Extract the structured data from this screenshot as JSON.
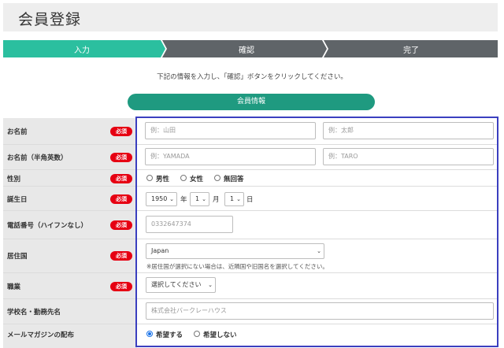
{
  "page_title": "会員登録",
  "steps": [
    {
      "label": "入力",
      "color": "#2bbf9f"
    },
    {
      "label": "確認",
      "color": "#5f6468"
    },
    {
      "label": "完了",
      "color": "#5f6468"
    }
  ],
  "instruction": "下記の情報を入力し、「確認」ボタンをクリックしてください。",
  "section_title": "会員情報",
  "required_badge": "必須",
  "form": {
    "name": {
      "label": "お名前",
      "last_placeholder": "例：山田",
      "first_placeholder": "例：太郎"
    },
    "name_en": {
      "label": "お名前（半角英数）",
      "last_placeholder": "例：YAMADA",
      "first_placeholder": "例：TARO"
    },
    "gender": {
      "label": "性別",
      "options": [
        "男性",
        "女性",
        "無回答"
      ]
    },
    "birthday": {
      "label": "誕生日",
      "year": "1950",
      "year_unit": "年",
      "month": "1",
      "month_unit": "月",
      "day": "1",
      "day_unit": "日"
    },
    "phone": {
      "label": "電話番号（ハイフンなし）",
      "placeholder": "0332647374"
    },
    "country": {
      "label": "居住国",
      "value": "Japan",
      "note": "※居住国が選択にない場合は、近隣国や旧国名を選択してください。"
    },
    "job": {
      "label": "職業",
      "value": "選択してください"
    },
    "school": {
      "label": "学校名・勤務先名",
      "placeholder": "株式会社バークレーハウス"
    },
    "newsletter": {
      "label": "メールマガジンの配布",
      "options": [
        "希望する",
        "希望しない"
      ],
      "selected": "希望する"
    }
  }
}
